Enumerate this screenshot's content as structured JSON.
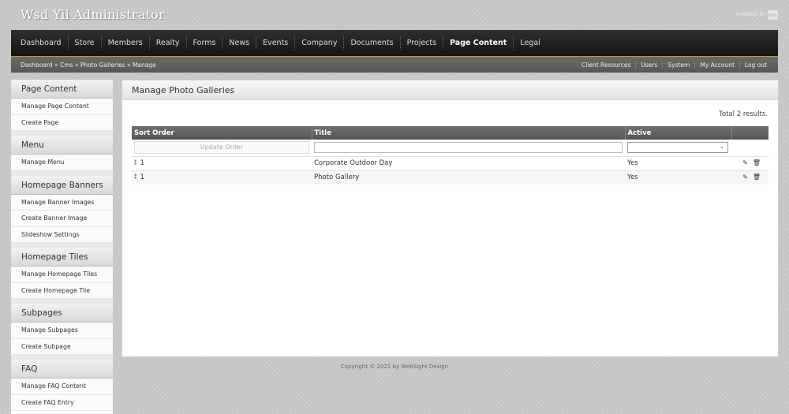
{
  "header": {
    "title": "Wsd Yii Administrator",
    "powered_by": "POWERED BY",
    "powered_logo": "WSD"
  },
  "nav": {
    "items": [
      "Dashboard",
      "Store",
      "Members",
      "Realty",
      "Forms",
      "News",
      "Events",
      "Company",
      "Documents",
      "Projects",
      "Page Content",
      "Legal"
    ],
    "active": "Page Content"
  },
  "breadcrumb": {
    "items": [
      "Dashboard",
      "Cms",
      "Photo Galleries",
      "Manage"
    ],
    "separator": "»"
  },
  "util_links": [
    "Client Resources",
    "Users",
    "System",
    "My Account",
    "Log out"
  ],
  "sidebar": {
    "sections": [
      {
        "title": "Page Content",
        "items": [
          "Manage Page Content",
          "Create Page"
        ]
      },
      {
        "title": "Menu",
        "items": [
          "Manage Menu"
        ]
      },
      {
        "title": "Homepage Banners",
        "items": [
          "Manage Banner Images",
          "Create Banner Image",
          "Slideshow Settings"
        ]
      },
      {
        "title": "Homepage Tiles",
        "items": [
          "Manage Homepage Tiles",
          "Create Homepage Tile"
        ]
      },
      {
        "title": "Subpages",
        "items": [
          "Manage Subpages",
          "Create Subpage"
        ]
      },
      {
        "title": "FAQ",
        "items": [
          "Manage FAQ Content",
          "Create FAQ Entry"
        ]
      }
    ]
  },
  "main": {
    "title": "Manage Photo Galleries",
    "summary": "Total 2 results.",
    "columns": [
      "Sort Order",
      "Title",
      "Active",
      ""
    ],
    "update_button": "Update Order",
    "title_filter_placeholder": "",
    "rows": [
      {
        "sort": "1",
        "title": "Corporate Outdoor Day",
        "active": "Yes"
      },
      {
        "sort": "1",
        "title": "Photo Gallery",
        "active": "Yes"
      }
    ]
  },
  "footer": {
    "text": "Copyright © 2021 by WebSight Design"
  },
  "colors": {
    "accent": "#c7932d",
    "nav_bg": "#1f1f1f",
    "header_text": "#ffffff"
  }
}
